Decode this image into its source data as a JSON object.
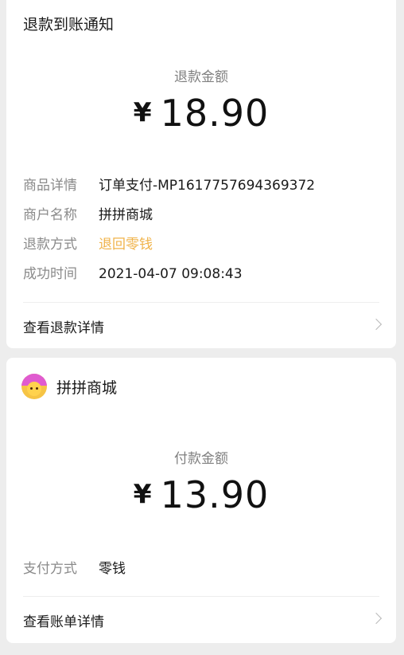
{
  "refund": {
    "title": "退款到账通知",
    "amount_label": "退款金额",
    "currency": "¥",
    "amount": "18.90",
    "details": [
      {
        "key": "商品详情",
        "value": "订单支付-MP1617757694369372",
        "color": "normal"
      },
      {
        "key": "商户名称",
        "value": "拼拼商城",
        "color": "normal"
      },
      {
        "key": "退款方式",
        "value": "退回零钱",
        "color": "#f0b34a"
      },
      {
        "key": "成功时间",
        "value": "2021-04-07 09:08:43",
        "color": "normal"
      }
    ],
    "link_label": "查看退款详情"
  },
  "payment": {
    "merchant_name": "拼拼商城",
    "amount_label": "付款金额",
    "currency": "¥",
    "amount": "13.90",
    "details": [
      {
        "key": "支付方式",
        "value": "零钱"
      }
    ],
    "link_label": "查看账单详情"
  },
  "colors": {
    "background": "#ededed",
    "card": "#ffffff",
    "accent_orange": "#f0b34a"
  }
}
